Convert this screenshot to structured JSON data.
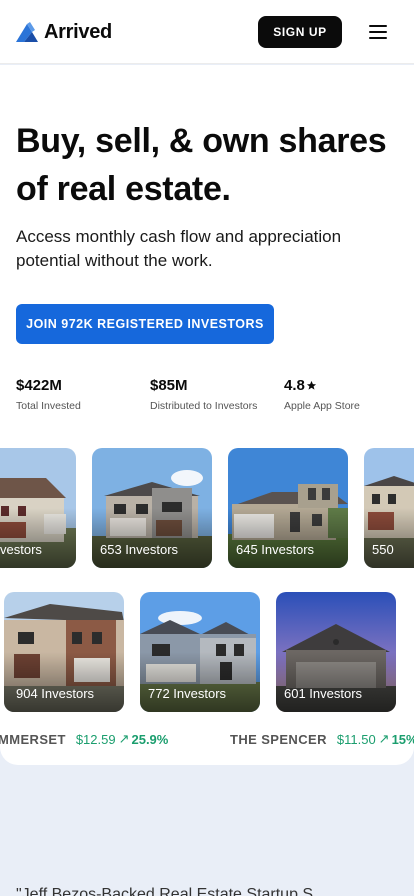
{
  "header": {
    "brand": "Arrived",
    "signup_label": "SIGN UP"
  },
  "hero": {
    "title_line1": "Buy, sell, & own shares",
    "title_line2": "of real estate.",
    "subtitle_line1": "Access monthly cash flow and appreciation",
    "subtitle_line2": "potential without the work.",
    "cta_label": "JOIN 972K REGISTERED INVESTORS"
  },
  "stats": [
    {
      "value": "$422M",
      "label": "Total Invested"
    },
    {
      "value": "$85M",
      "label": "Distributed to Investors"
    },
    {
      "value": "4.8",
      "label": "Apple App Store",
      "icon": "star-icon"
    }
  ],
  "properties_row1": [
    {
      "label": "vestors"
    },
    {
      "label": "653 Investors"
    },
    {
      "label": "645 Investors"
    },
    {
      "label": "550"
    }
  ],
  "properties_row2": [
    {
      "label": "904 Investors"
    },
    {
      "label": "772 Investors"
    },
    {
      "label": "601 Investors"
    }
  ],
  "ticker": [
    {
      "name": "MMERSET",
      "price": "$12.59",
      "change": "25.9%"
    },
    {
      "name": "THE SPENCER",
      "price": "$11.50",
      "change": "15%"
    }
  ],
  "bottom_text": "\"Jeff Bezos-Backed Real Estate Startup S",
  "colors": {
    "accent": "#1668dc",
    "positive": "#1b9e6e",
    "background": "#e9eef7"
  }
}
